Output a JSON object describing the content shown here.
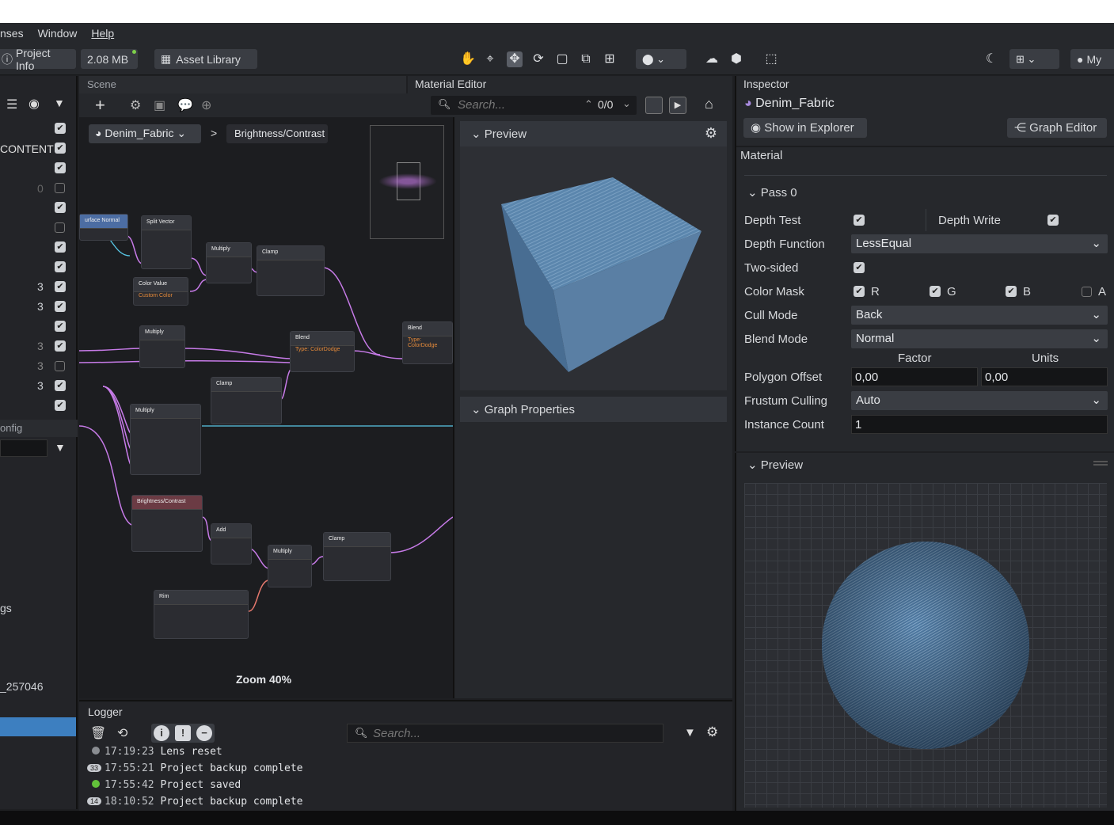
{
  "menu": {
    "items": [
      "nses",
      "Window",
      "Help"
    ]
  },
  "toolbar": {
    "project_info": "Project Info",
    "memory": "2.08 MB",
    "asset_library": "Asset Library",
    "my": "My"
  },
  "left": {
    "content_label": "CONTENT",
    "counts": [
      "0",
      "3",
      "3",
      "3",
      "3",
      "3"
    ],
    "config_label": "onfig",
    "gs_label": "gs",
    "id_label": "_257046"
  },
  "scene": {
    "tab": "Scene"
  },
  "material_editor": {
    "tab": "Material Editor",
    "search_placeholder": "Search...",
    "search_count": "0/0",
    "breadcrumb_root": "Denim_Fabric",
    "breadcrumb_sep": ">",
    "breadcrumb_child": "Brightness/Contrast",
    "zoom": "Zoom 40%",
    "preview_title": "Preview",
    "graph_properties": "Graph Properties"
  },
  "nodes": {
    "surface_normal": "urface Normal",
    "split_vector": "Split Vector",
    "multiply": "Multiply",
    "clamp": "Clamp",
    "color_value": "Color Value",
    "custom_color": "Custom Color",
    "blend": "Blend",
    "blend_type": "Type: ColorDodge",
    "brightness_contrast": "Brightness/Contrast",
    "add": "Add",
    "rim": "Rim"
  },
  "logger": {
    "title": "Logger",
    "search_placeholder": "Search...",
    "entries": [
      {
        "badge": "",
        "time": "17:19:23",
        "text": "Lens reset"
      },
      {
        "badge": "33",
        "time": "17:55:21",
        "text": "Project backup complete"
      },
      {
        "badge": "",
        "time": "17:55:42",
        "text": "Project saved"
      },
      {
        "badge": "14",
        "time": "18:10:52",
        "text": "Project backup complete"
      }
    ]
  },
  "inspector": {
    "title": "Inspector",
    "asset_name": "Denim_Fabric",
    "show_in_explorer": "Show in Explorer",
    "graph_editor": "Graph Editor",
    "material_label": "Material",
    "pass": "Pass 0",
    "depth_test": "Depth Test",
    "depth_write": "Depth Write",
    "depth_function": "Depth Function",
    "depth_function_value": "LessEqual",
    "two_sided": "Two-sided",
    "color_mask": "Color Mask",
    "mask_r": "R",
    "mask_g": "G",
    "mask_b": "B",
    "mask_a": "A",
    "cull_mode": "Cull Mode",
    "cull_mode_value": "Back",
    "blend_mode": "Blend Mode",
    "blend_mode_value": "Normal",
    "factor": "Factor",
    "units": "Units",
    "polygon_offset": "Polygon Offset",
    "factor_value": "0,00",
    "units_value": "0,00",
    "frustum_culling": "Frustum Culling",
    "frustum_culling_value": "Auto",
    "instance_count": "Instance Count",
    "instance_count_value": "1",
    "preview_title": "Preview"
  },
  "colors": {
    "accent": "#3d7fc0",
    "denim": "#5b86ad",
    "wire": "#c77be8"
  }
}
